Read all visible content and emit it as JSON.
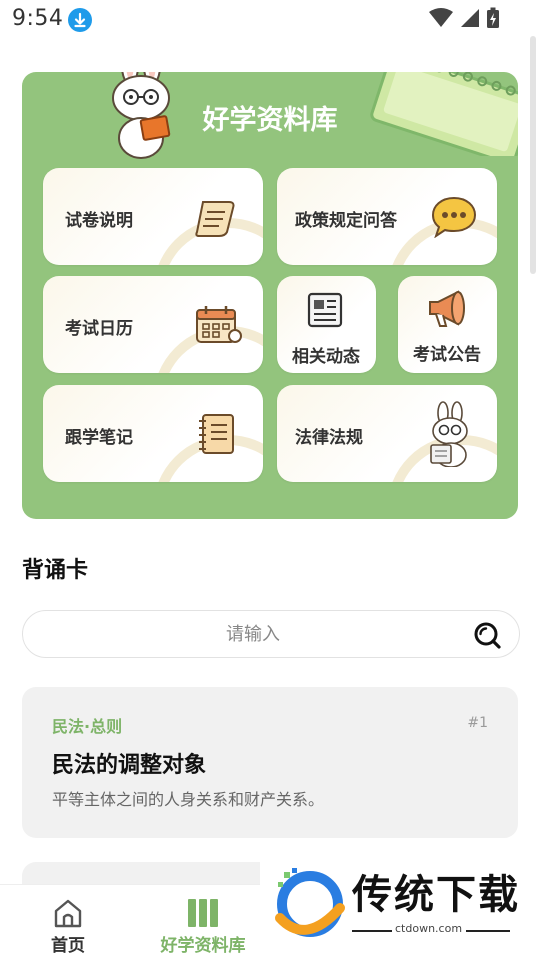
{
  "status_bar": {
    "time": "9:54",
    "icons": [
      "download-icon",
      "wifi-icon",
      "signal-icon",
      "battery-charging-icon"
    ]
  },
  "banner": {
    "title": "好学资料库",
    "background_color": "#93c47d",
    "tiles": [
      {
        "id": "exam-instructions",
        "label": "试卷说明",
        "icon": "scroll-icon"
      },
      {
        "id": "policy-qa",
        "label": "政策规定问答",
        "icon": "chat-bubble-icon"
      },
      {
        "id": "exam-calendar",
        "label": "考试日历",
        "icon": "calendar-icon"
      },
      {
        "id": "related-news",
        "label": "相关动态",
        "icon": "newspaper-icon"
      },
      {
        "id": "exam-announcement",
        "label": "考试公告",
        "icon": "megaphone-icon"
      },
      {
        "id": "study-notes",
        "label": "跟学笔记",
        "icon": "notebook-icon"
      },
      {
        "id": "laws-regulations",
        "label": "法律法规",
        "icon": "bunny-reading-icon"
      }
    ]
  },
  "recite_section": {
    "title": "背诵卡",
    "search_placeholder": "请输入",
    "search_value": ""
  },
  "cards": [
    {
      "category": "民法·总则",
      "number": "#1",
      "title": "民法的调整对象",
      "description": "平等主体之间的人身关系和财产关系。"
    }
  ],
  "bottom_nav": {
    "active_color": "#7eb468",
    "items": [
      {
        "label": "首页",
        "icon": "home-icon",
        "active": false
      },
      {
        "label": "好学资料库",
        "icon": "books-icon",
        "active": true
      }
    ]
  },
  "watermark": {
    "text": "传统下载",
    "url": "ctdown.com"
  }
}
